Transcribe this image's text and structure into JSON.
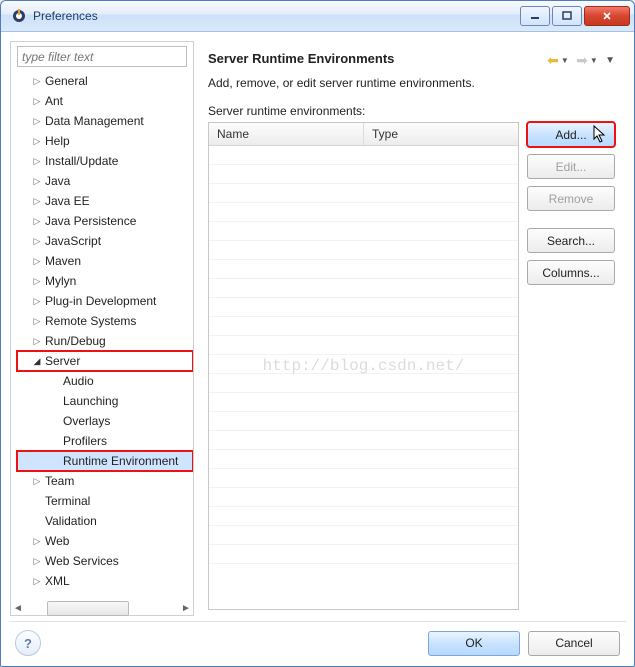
{
  "window": {
    "title": "Preferences"
  },
  "filter": {
    "placeholder": "type filter text"
  },
  "tree": {
    "items": [
      {
        "label": "General",
        "depth": 1,
        "expandable": true,
        "expanded": false
      },
      {
        "label": "Ant",
        "depth": 1,
        "expandable": true,
        "expanded": false
      },
      {
        "label": "Data Management",
        "depth": 1,
        "expandable": true,
        "expanded": false
      },
      {
        "label": "Help",
        "depth": 1,
        "expandable": true,
        "expanded": false
      },
      {
        "label": "Install/Update",
        "depth": 1,
        "expandable": true,
        "expanded": false
      },
      {
        "label": "Java",
        "depth": 1,
        "expandable": true,
        "expanded": false
      },
      {
        "label": "Java EE",
        "depth": 1,
        "expandable": true,
        "expanded": false
      },
      {
        "label": "Java Persistence",
        "depth": 1,
        "expandable": true,
        "expanded": false
      },
      {
        "label": "JavaScript",
        "depth": 1,
        "expandable": true,
        "expanded": false
      },
      {
        "label": "Maven",
        "depth": 1,
        "expandable": true,
        "expanded": false
      },
      {
        "label": "Mylyn",
        "depth": 1,
        "expandable": true,
        "expanded": false
      },
      {
        "label": "Plug-in Development",
        "depth": 1,
        "expandable": true,
        "expanded": false
      },
      {
        "label": "Remote Systems",
        "depth": 1,
        "expandable": true,
        "expanded": false
      },
      {
        "label": "Run/Debug",
        "depth": 1,
        "expandable": true,
        "expanded": false
      },
      {
        "label": "Server",
        "depth": 1,
        "expandable": true,
        "expanded": true,
        "highlight": true
      },
      {
        "label": "Audio",
        "depth": 2,
        "expandable": false
      },
      {
        "label": "Launching",
        "depth": 2,
        "expandable": false
      },
      {
        "label": "Overlays",
        "depth": 2,
        "expandable": false
      },
      {
        "label": "Profilers",
        "depth": 2,
        "expandable": false
      },
      {
        "label": "Runtime Environment",
        "depth": 2,
        "expandable": false,
        "selected": true,
        "highlight": true
      },
      {
        "label": "Team",
        "depth": 1,
        "expandable": true,
        "expanded": false
      },
      {
        "label": "Terminal",
        "depth": 1,
        "expandable": false
      },
      {
        "label": "Validation",
        "depth": 1,
        "expandable": false
      },
      {
        "label": "Web",
        "depth": 1,
        "expandable": true,
        "expanded": false
      },
      {
        "label": "Web Services",
        "depth": 1,
        "expandable": true,
        "expanded": false
      },
      {
        "label": "XML",
        "depth": 1,
        "expandable": true,
        "expanded": false
      }
    ]
  },
  "page": {
    "title": "Server Runtime Environments",
    "description": "Add, remove, or edit server runtime environments.",
    "table_label": "Server runtime environments:",
    "columns": {
      "name": "Name",
      "type": "Type"
    },
    "watermark": "http://blog.csdn.net/"
  },
  "buttons": {
    "add": "Add...",
    "edit": "Edit...",
    "remove": "Remove",
    "search": "Search...",
    "columns": "Columns..."
  },
  "footer": {
    "ok": "OK",
    "cancel": "Cancel"
  }
}
